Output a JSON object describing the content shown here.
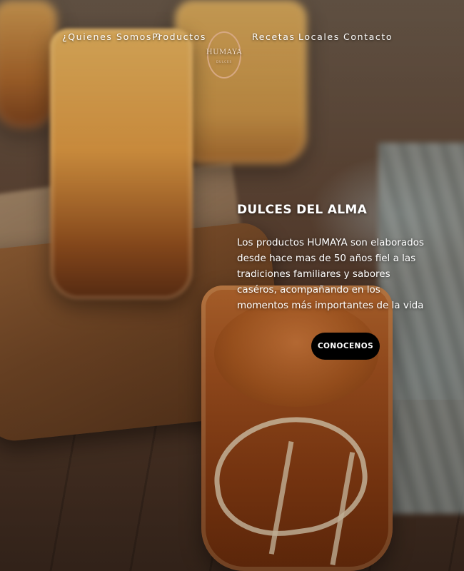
{
  "nav": {
    "items": [
      {
        "label": "¿Quienes Somos ?"
      },
      {
        "label": "Productos"
      },
      {
        "label": "Recetas"
      },
      {
        "label": "Locales"
      },
      {
        "label": "Contacto"
      }
    ]
  },
  "logo": {
    "name": "HUMAYA",
    "subtitle": "DULCES"
  },
  "hero": {
    "title": "DULCES DEL ALMA",
    "body": "Los productos HUMAYA son elaborados desde hace mas de 50 años fiel a las tradiciones familiares y sabores caséros, acompañando en los momentos más importantes de la vida",
    "cta_label": "CONOCENOS"
  },
  "colors": {
    "accent": "#d6a882",
    "cta_background": "#000000",
    "text": "#ffffff"
  }
}
